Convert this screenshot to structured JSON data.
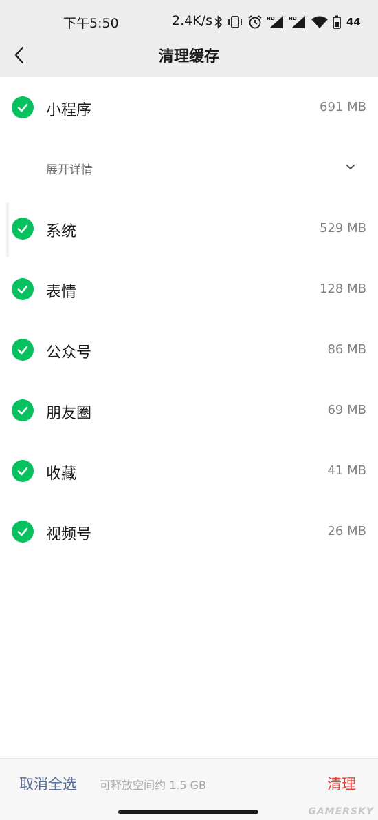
{
  "status_bar": {
    "time": "下午5:50",
    "network_speed": "2.4K/s",
    "battery_level": "44",
    "icons": [
      "bluetooth-icon",
      "vibrate-icon",
      "alarm-icon",
      "hd-signal-icon",
      "hd-signal-icon",
      "wifi-icon",
      "battery-icon"
    ]
  },
  "header": {
    "title": "清理缓存",
    "back_icon": "chevron-left-icon"
  },
  "expand": {
    "label": "展开详情",
    "icon": "chevron-down-icon"
  },
  "items": [
    {
      "label": "小程序",
      "size": "691 MB",
      "checked": true
    },
    {
      "label": "系统",
      "size": "529 MB",
      "checked": true
    },
    {
      "label": "表情",
      "size": "128 MB",
      "checked": true
    },
    {
      "label": "公众号",
      "size": "86 MB",
      "checked": true
    },
    {
      "label": "朋友圈",
      "size": "69 MB",
      "checked": true
    },
    {
      "label": "收藏",
      "size": "41 MB",
      "checked": true
    },
    {
      "label": "视频号",
      "size": "26 MB",
      "checked": true
    }
  ],
  "footer": {
    "deselect_all": "取消全选",
    "free_space": "可释放空间约 1.5 GB",
    "clean": "清理"
  },
  "watermark": "GAMERSKY",
  "colors": {
    "accent_green": "#07c160",
    "link_blue": "#576b95",
    "danger_red": "#e64340",
    "header_bg": "#ededed"
  }
}
